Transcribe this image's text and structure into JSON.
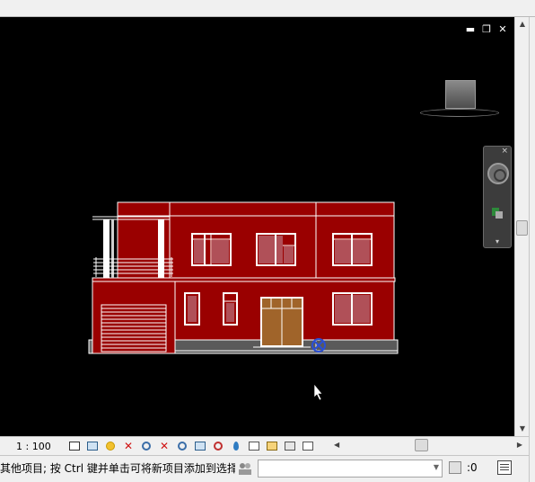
{
  "window": {
    "controls": [
      "minimize",
      "restore",
      "close"
    ]
  },
  "viewcube": {
    "icon": "viewcube-icon"
  },
  "navbar": {
    "close": "×",
    "expand": "▾"
  },
  "viewbar": {
    "scale": "1 : 100",
    "icons": [
      "detail-level-icon",
      "visual-style-icon",
      "sun-path-icon",
      "shadows-icon",
      "crop-view-icon",
      "show-crop-icon",
      "unlock-3d-icon",
      "temporary-hide-icon",
      "reveal-hidden-icon",
      "temporary-view-properties-icon",
      "analysis-display-icon",
      "highlight-displacement-icon",
      "reveal-constraints-icon",
      "worksharing-display-icon",
      "design-options-icon"
    ]
  },
  "statusbar": {
    "message": "其他项目; 按 Ctrl 键并单击可将新项目添加到选择!",
    "selection_count": ":0",
    "input_value": ""
  },
  "colors": {
    "wall_red": "#9a0000",
    "door_brown": "#a0642a",
    "viewport_bg": "#000000"
  }
}
